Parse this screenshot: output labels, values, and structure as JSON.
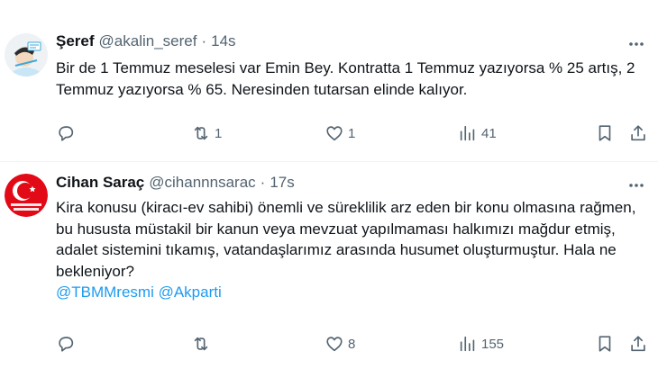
{
  "tweets": [
    {
      "name": "Şeref",
      "handle": "@akalin_seref",
      "separator": "·",
      "time": "14s",
      "text": "Bir de 1 Temmuz meselesi var Emin Bey. Kontratta 1 Temmuz yazıyorsa % 25 artış, 2 Temmuz yazıyorsa % 65. Neresinden tutarsan elinde kalıyor.",
      "mentions": "",
      "avatar_icon": "cartoon-avatar-icon",
      "counts": {
        "replies": "",
        "retweets": "1",
        "likes": "1",
        "views": "41"
      }
    },
    {
      "name": "Cihan Saraç",
      "handle": "@cihannnsarac",
      "separator": "·",
      "time": "17s",
      "text": "Kira konusu (kiracı-ev sahibi) önemli ve süreklilik arz eden bir konu olmasına rağmen, bu hususta müstakil bir kanun veya mevzuat yapılmaması halkımızı mağdur etmiş, adalet sistemini tıkamış, vatandaşlarımız arasında husumet oluşturmuştur. Hala ne bekleniyor?",
      "mentions": "@TBMMresmi @Akparti",
      "avatar_icon": "turkiye-yuzyili-logo-icon",
      "counts": {
        "replies": "",
        "retweets": "",
        "likes": "8",
        "views": "155"
      }
    }
  ],
  "colors": {
    "text": "#0f1419",
    "secondary": "#536471",
    "link": "#1d9bf0",
    "divider": "#eff3f4"
  }
}
